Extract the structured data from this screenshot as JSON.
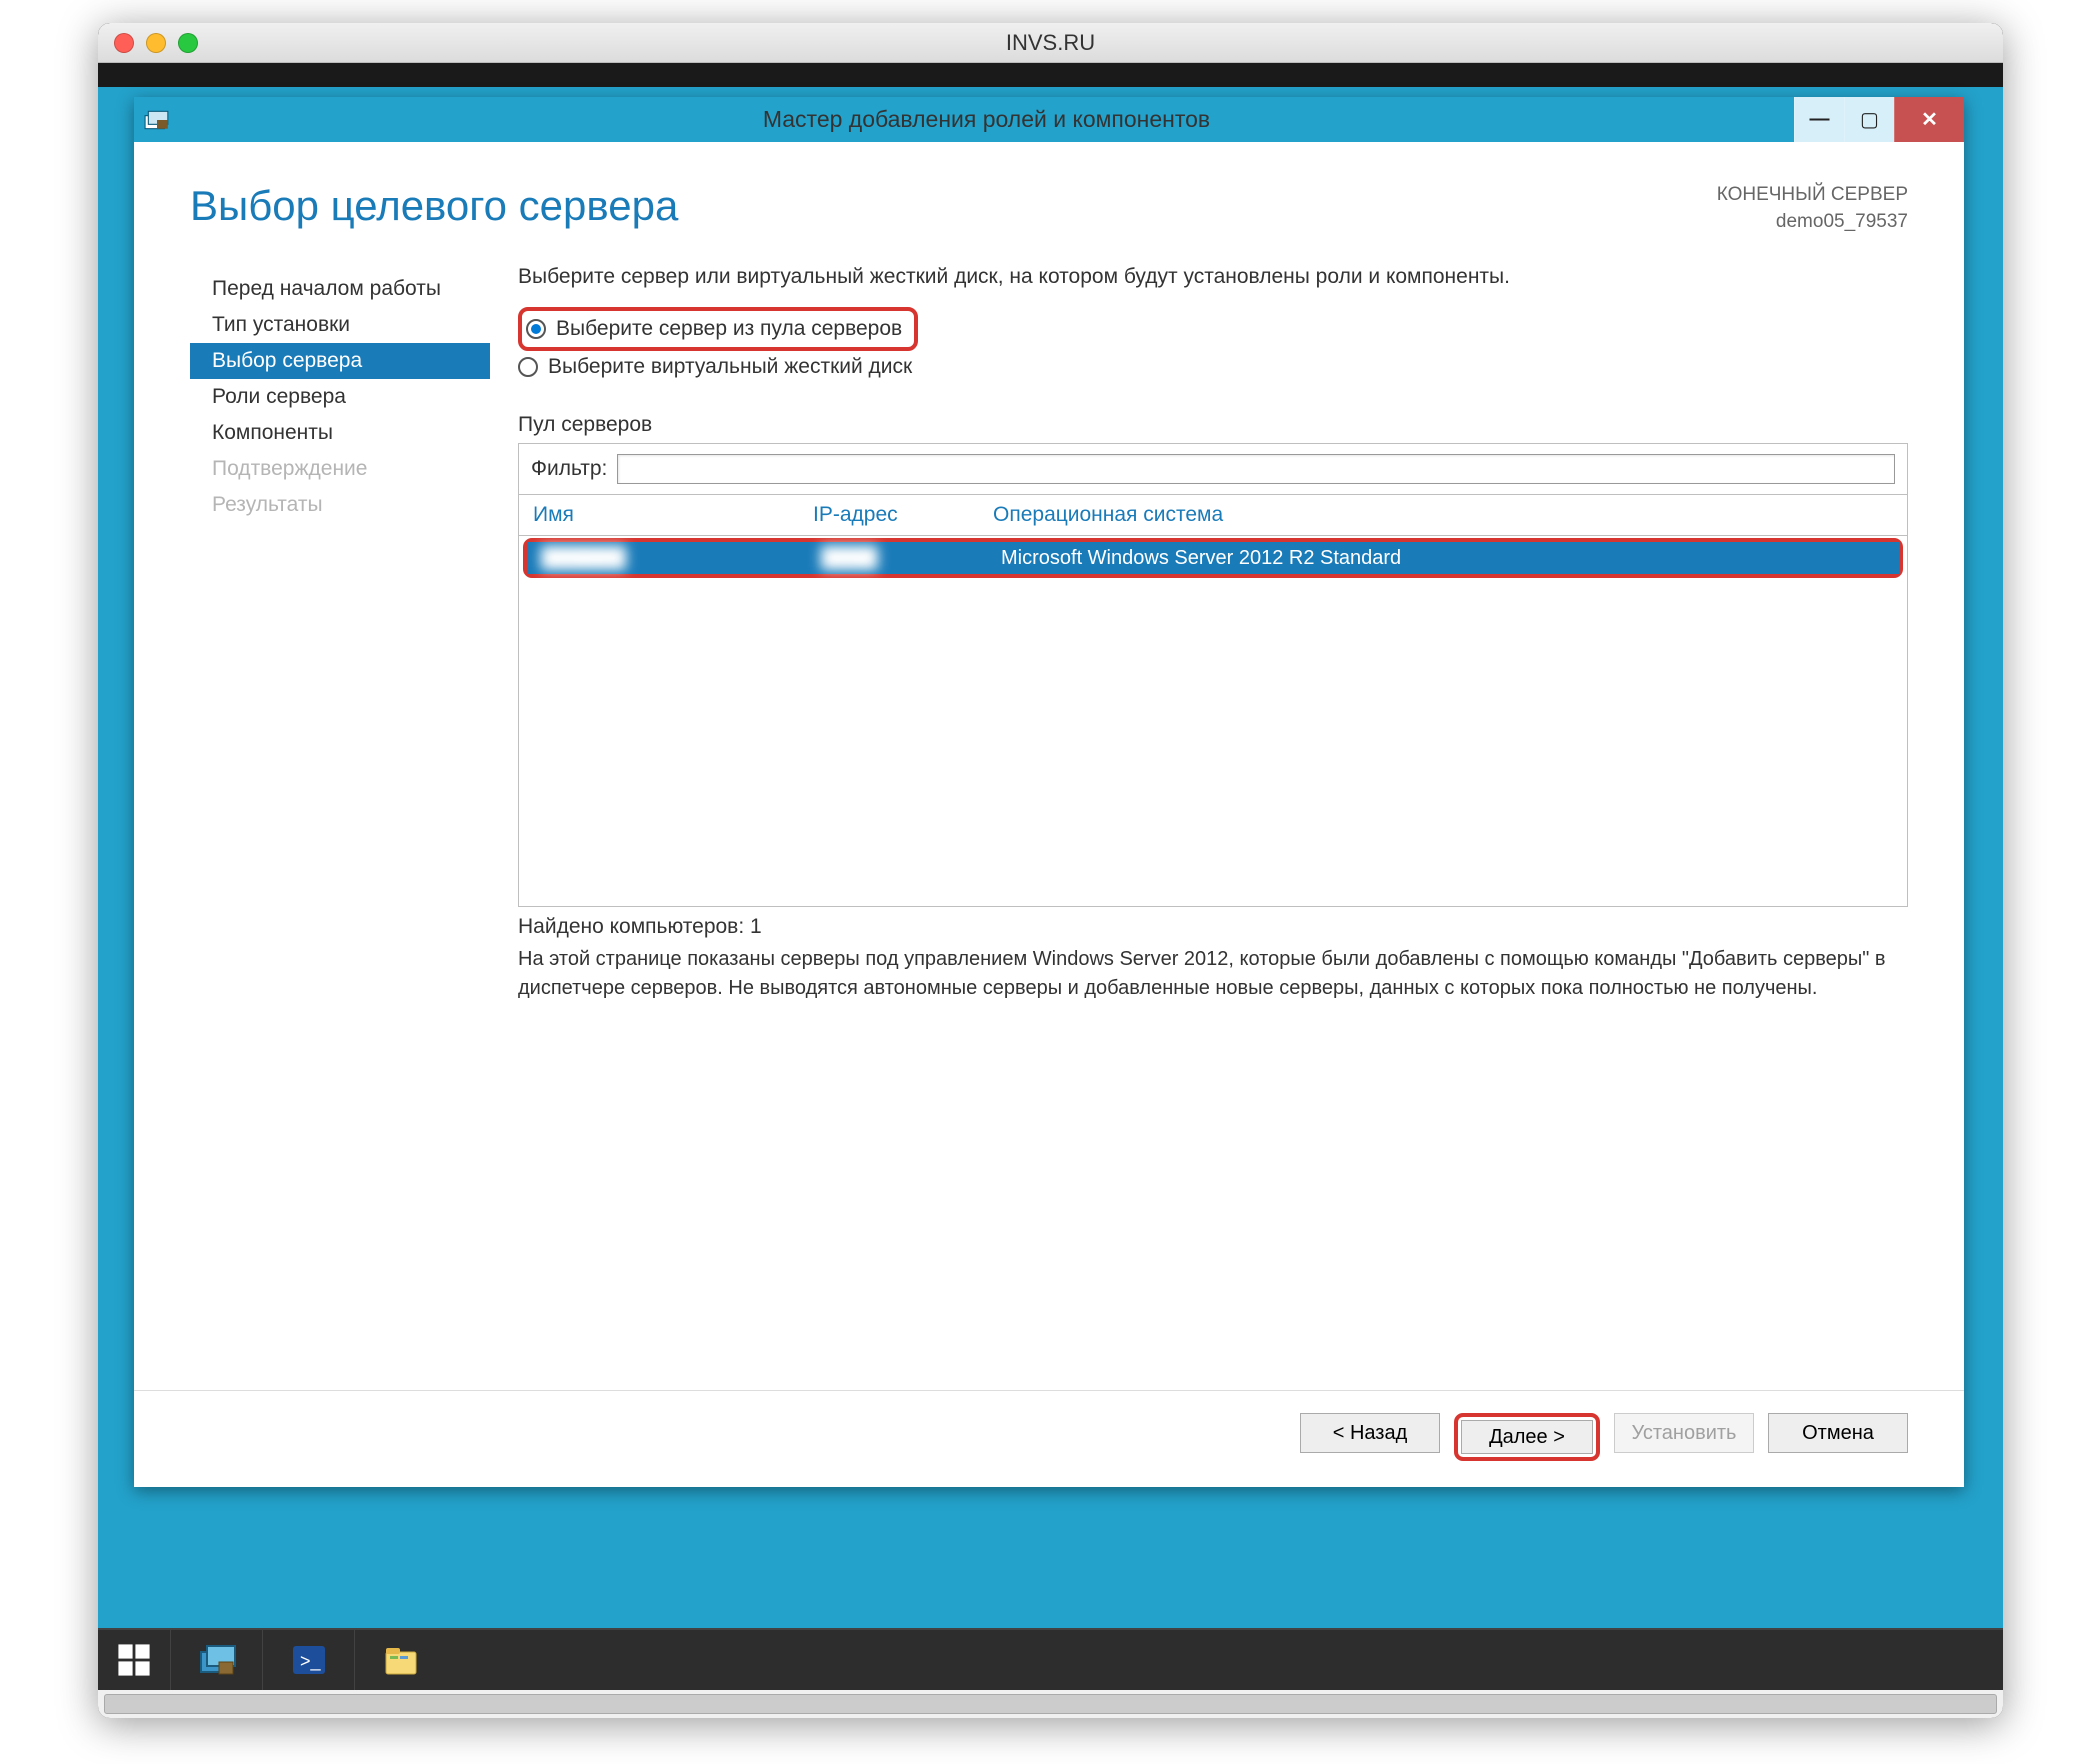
{
  "mac_title": "INVS.RU",
  "wizard": {
    "title": "Мастер добавления ролей и компонентов",
    "page_heading": "Выбор целевого сервера",
    "dest_label": "КОНЕЧНЫЙ СЕРВЕР",
    "dest_server": "demo05_79537",
    "instruction": "Выберите сервер или виртуальный жесткий диск, на котором будут установлены роли и компоненты.",
    "radio_pool": "Выберите сервер из пула серверов",
    "radio_vhd": "Выберите виртуальный жесткий диск",
    "pool_heading": "Пул серверов",
    "filter_label": "Фильтр:",
    "columns": {
      "name": "Имя",
      "ip": "IP-адрес",
      "os": "Операционная система"
    },
    "rows": [
      {
        "name": "██████",
        "ip": "████",
        "os": "Microsoft Windows Server 2012 R2 Standard"
      }
    ],
    "found_prefix": "Найдено компьютеров: ",
    "found_count": "1",
    "explanation": "На этой странице показаны серверы под управлением Windows Server 2012, которые были добавлены с помощью команды \"Добавить серверы\" в диспетчере серверов. Не выводятся автономные серверы и добавленные новые серверы, данных с которых пока полностью не получены.",
    "nav": {
      "before_begin": "Перед началом работы",
      "install_type": "Тип установки",
      "server_select": "Выбор сервера",
      "server_roles": "Роли сервера",
      "features": "Компоненты",
      "confirm": "Подтверждение",
      "results": "Результаты"
    },
    "buttons": {
      "back": "< Назад",
      "next": "Далее >",
      "install": "Установить",
      "cancel": "Отмена"
    }
  }
}
